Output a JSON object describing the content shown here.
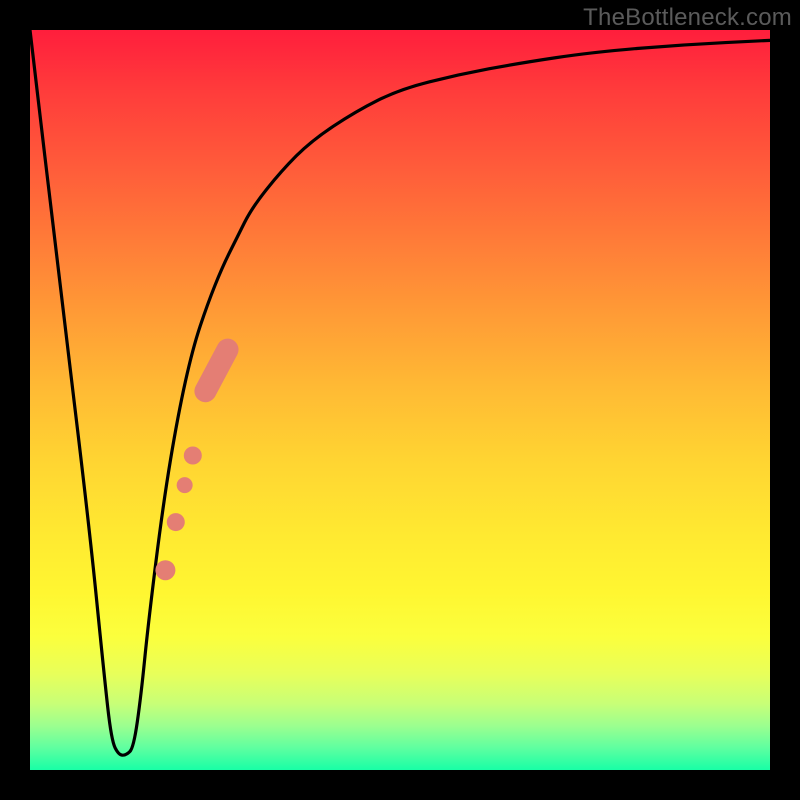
{
  "watermark": "TheBottleneck.com",
  "colors": {
    "frame": "#000000",
    "curve_stroke": "#000000",
    "marker_fill": "#e47e74",
    "marker_stroke": "#e47e74"
  },
  "chart_data": {
    "type": "line",
    "title": "",
    "xlabel": "",
    "ylabel": "",
    "xlim": [
      0,
      100
    ],
    "ylim": [
      0,
      100
    ],
    "grid": false,
    "legend": false,
    "series": [
      {
        "name": "bottleneck-curve",
        "x": [
          0,
          4,
          8,
          10,
          11,
          12,
          13,
          14,
          15,
          16,
          18,
          20,
          22,
          24,
          26,
          28,
          30,
          34,
          38,
          44,
          50,
          58,
          66,
          76,
          88,
          100
        ],
        "y": [
          100,
          66,
          33,
          13,
          4,
          2,
          2,
          3,
          10,
          20,
          36,
          48,
          57,
          63,
          68,
          72,
          76,
          81,
          85,
          89,
          92,
          94,
          95.5,
          97,
          98,
          98.6
        ]
      }
    ],
    "markers": [
      {
        "shape": "pill",
        "cx": 25.2,
        "cy": 54.0,
        "length": 25,
        "angle_deg": 62
      },
      {
        "shape": "circle",
        "cx": 22.0,
        "cy": 42.5,
        "r": 9
      },
      {
        "shape": "circle",
        "cx": 20.9,
        "cy": 38.5,
        "r": 8
      },
      {
        "shape": "circle",
        "cx": 19.7,
        "cy": 33.5,
        "r": 9
      },
      {
        "shape": "circle",
        "cx": 18.3,
        "cy": 27.0,
        "r": 10
      }
    ]
  }
}
